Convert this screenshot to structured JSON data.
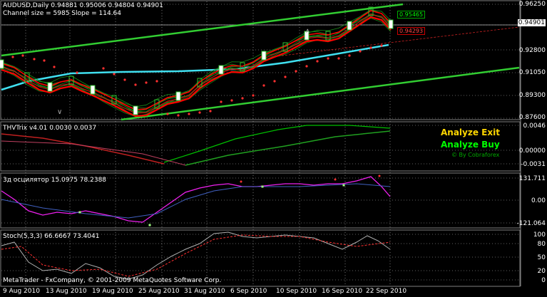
{
  "main": {
    "title": "AUDUSD,Daily  0.94881 0.95006 0.94804 0.94901",
    "channel_info": "Channel size = 5985 Slope = 114.64",
    "price_ticks": [
      "0.96250",
      "0.94901",
      "0.92800",
      "0.91050",
      "0.89300",
      "0.87600"
    ],
    "tag_green": "0.95465",
    "tag_red": "0.94293",
    "current_price": "0.94901"
  },
  "thv": {
    "title": "THVTrix v4.01 0.0030 0.0037",
    "ticks": [
      "0.0046",
      "0.00000",
      "-0.0031"
    ],
    "analyze_exit": "Analyze Exit",
    "analyze_buy": "Analyze Buy",
    "brand": "© By Cobraforex"
  },
  "osc": {
    "title": "3д осцилятор 15.0975 78.2388",
    "ticks": [
      "131.711",
      "0.00",
      "-121.064"
    ]
  },
  "stoch": {
    "title": "Stoch(5,3,3) 66.6667 73.4041",
    "ticks": [
      "100",
      "80",
      "50",
      "20",
      "0"
    ]
  },
  "copyright": "MetaTrader - FxCompany, © 2001-2009 MetaQuotes Software Corp.",
  "dates": [
    "9 Aug 2010",
    "13 Aug 2010",
    "19 Aug 2010",
    "25 Aug 2010",
    "31 Aug 2010",
    "6 Sep 2010",
    "10 Sep 2010",
    "16 Sep 2010",
    "22 Sep 2010"
  ],
  "colors": {
    "bg": "#000000",
    "grid": "#c0c0c0",
    "channel": "#32cd32",
    "ma_red": "#ff0000",
    "ma_cyan": "#40e0f0",
    "exit": "#ffd700",
    "buy": "#00ff00",
    "osc_line": "#ee20ee"
  }
}
